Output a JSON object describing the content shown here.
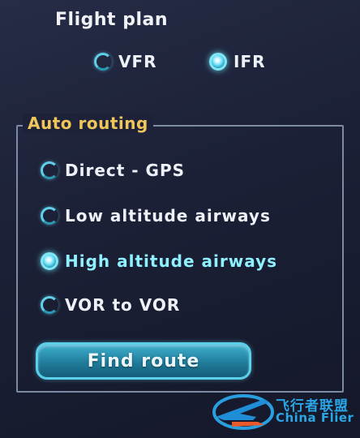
{
  "flight_plan": {
    "title": "Flight plan",
    "options": [
      {
        "label": "VFR",
        "selected": false
      },
      {
        "label": "IFR",
        "selected": true
      }
    ]
  },
  "auto_routing": {
    "title": "Auto routing",
    "options": [
      {
        "label": "Direct - GPS",
        "selected": false
      },
      {
        "label": "Low altitude airways",
        "selected": false
      },
      {
        "label": "High altitude airways",
        "selected": true
      },
      {
        "label": "VOR to VOR",
        "selected": false
      }
    ]
  },
  "find_button": {
    "label": "Find route"
  },
  "watermark": {
    "cn": "飞行者联盟",
    "en": "China Flier"
  },
  "colors": {
    "accent": "#5fd0e8",
    "legend": "#f0c65a",
    "background": "#1d2239"
  }
}
